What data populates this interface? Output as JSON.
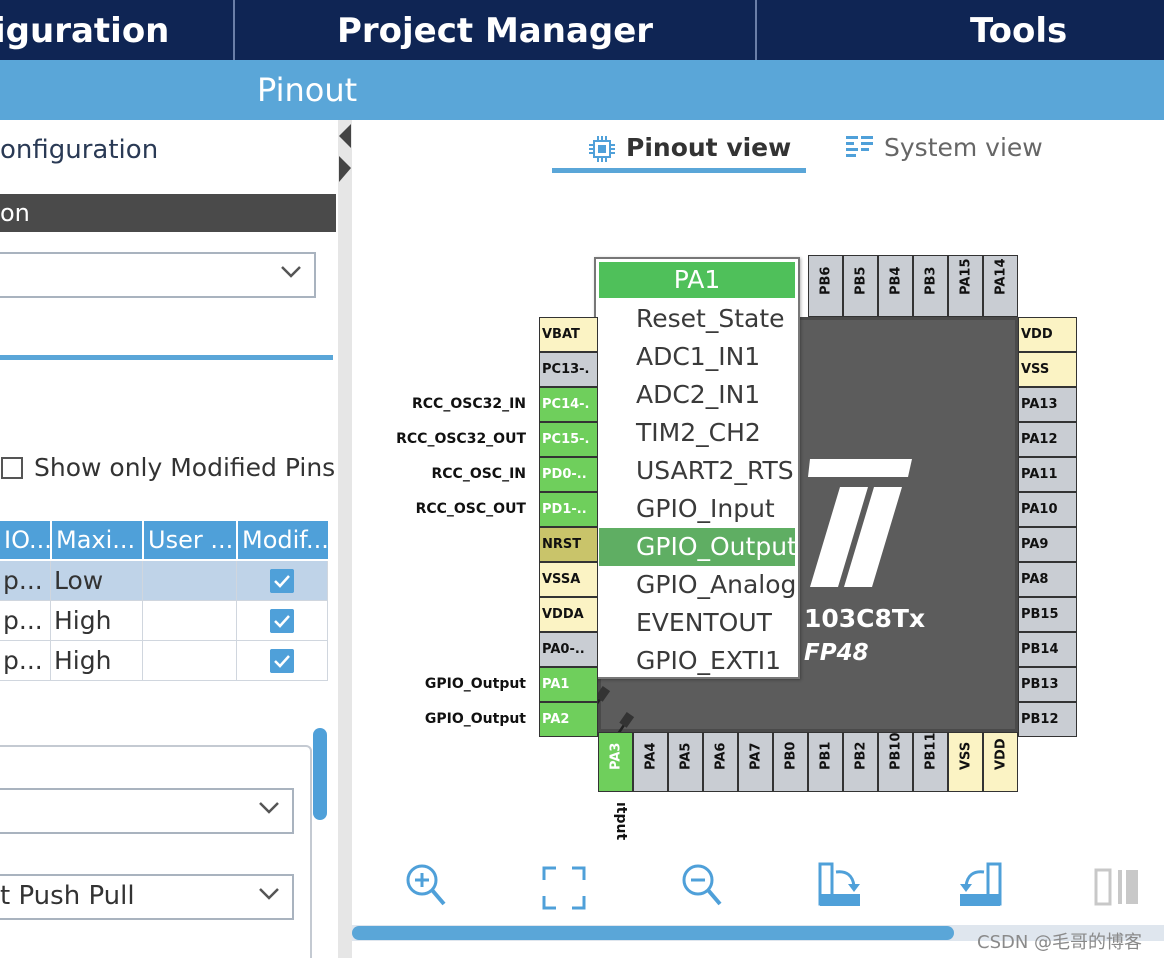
{
  "topnav": {
    "tabs": [
      "iguration",
      "Project Manager",
      "Tools"
    ]
  },
  "subbar": {
    "label": "Pinout"
  },
  "left_panel": {
    "header": "onfiguration",
    "section_title": "on",
    "mode_select": {
      "value": ""
    },
    "show_modified": {
      "label": "Show only Modified Pins",
      "checked": false
    },
    "table": {
      "columns": [
        "IO...",
        "Maxi...",
        "User ...",
        "Modif..."
      ],
      "rows": [
        {
          "io": "p...",
          "max": "Low",
          "user": "",
          "modified": true
        },
        {
          "io": "p...",
          "max": "High",
          "user": "",
          "modified": true
        },
        {
          "io": "p...",
          "max": "High",
          "user": "",
          "modified": true
        }
      ]
    },
    "detail_select_1": {
      "value": ""
    },
    "detail_select_2": {
      "value": "t Push Pull"
    }
  },
  "view_tabs": {
    "pinout": "Pinout view",
    "system": "System view"
  },
  "chip": {
    "name_partial": "103C8Tx",
    "package_partial": "FP48",
    "top_pins": [
      "PB6",
      "PB5",
      "PB4",
      "PB3",
      "PA15",
      "PA14"
    ],
    "left_pins": [
      {
        "name": "VBAT",
        "color": "yellow",
        "signal": ""
      },
      {
        "name": "PC13-.",
        "color": "gray",
        "signal": ""
      },
      {
        "name": "PC14-.",
        "color": "green",
        "signal": "RCC_OSC32_IN"
      },
      {
        "name": "PC15-.",
        "color": "green",
        "signal": "RCC_OSC32_OUT"
      },
      {
        "name": "PD0-..",
        "color": "green",
        "signal": "RCC_OSC_IN"
      },
      {
        "name": "PD1-..",
        "color": "green",
        "signal": "RCC_OSC_OUT"
      },
      {
        "name": "NRST",
        "color": "olive",
        "signal": ""
      },
      {
        "name": "VSSA",
        "color": "yellow",
        "signal": ""
      },
      {
        "name": "VDDA",
        "color": "yellow",
        "signal": ""
      },
      {
        "name": "PA0-..",
        "color": "gray",
        "signal": ""
      },
      {
        "name": "PA1",
        "color": "green",
        "signal": "GPIO_Output"
      },
      {
        "name": "PA2",
        "color": "green",
        "signal": "GPIO_Output"
      }
    ],
    "right_pins": [
      {
        "name": "VDD",
        "color": "yellow"
      },
      {
        "name": "VSS",
        "color": "yellow"
      },
      {
        "name": "PA13",
        "color": "gray"
      },
      {
        "name": "PA12",
        "color": "gray"
      },
      {
        "name": "PA11",
        "color": "gray"
      },
      {
        "name": "PA10",
        "color": "gray"
      },
      {
        "name": "PA9",
        "color": "gray"
      },
      {
        "name": "PA8",
        "color": "gray"
      },
      {
        "name": "PB15",
        "color": "gray"
      },
      {
        "name": "PB14",
        "color": "gray"
      },
      {
        "name": "PB13",
        "color": "gray"
      },
      {
        "name": "PB12",
        "color": "gray"
      }
    ],
    "bottom_pins": [
      {
        "name": "PA3",
        "color": "green"
      },
      {
        "name": "PA4",
        "color": "gray"
      },
      {
        "name": "PA5",
        "color": "gray"
      },
      {
        "name": "PA6",
        "color": "gray"
      },
      {
        "name": "PA7",
        "color": "gray"
      },
      {
        "name": "PB0",
        "color": "gray"
      },
      {
        "name": "PB1",
        "color": "gray"
      },
      {
        "name": "PB2",
        "color": "gray"
      },
      {
        "name": "PB10",
        "color": "gray"
      },
      {
        "name": "PB11",
        "color": "gray"
      },
      {
        "name": "VSS",
        "color": "yellow"
      },
      {
        "name": "VDD",
        "color": "yellow"
      }
    ],
    "bottom_signal_pa3": "ıtput"
  },
  "pin_menu": {
    "title": "PA1",
    "items": [
      "Reset_State",
      "ADC1_IN1",
      "ADC2_IN1",
      "TIM2_CH2",
      "USART2_RTS",
      "GPIO_Input",
      "GPIO_Output",
      "GPIO_Analog",
      "EVENTOUT",
      "GPIO_EXTI1"
    ],
    "selected": "GPIO_Output"
  },
  "toolbar": {
    "icons": [
      "zoom-in-icon",
      "fit-screen-icon",
      "zoom-out-icon",
      "rotate-right-icon",
      "rotate-left-icon",
      "split-view-icon"
    ]
  },
  "watermark": "CSDN @毛哥的博客",
  "colors": {
    "nav": "#0f2554",
    "accent": "#5aa6d8",
    "pin_green": "#6fcf5c",
    "menu_selected": "#5fae63"
  }
}
